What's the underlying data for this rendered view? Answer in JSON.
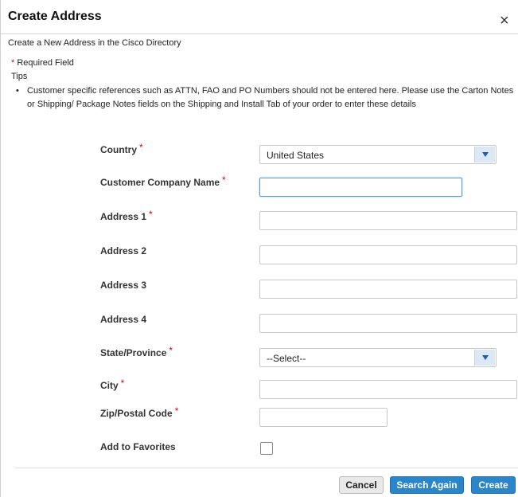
{
  "dialog": {
    "title": "Create Address",
    "close_glyph": "×",
    "subtitle": "Create a New Address in the Cisco Directory"
  },
  "notes": {
    "required_star": "*",
    "required_text": "Required Field",
    "tips_heading": "Tips",
    "tip_bullet": "•",
    "tip_text": "Customer specific references such as ATTN, FAO and PO Numbers should not be entered here. Please use the Carton Notes or Shipping/ Package Notes fields on the Shipping and Install Tab of your order to enter these details"
  },
  "form": {
    "required_star": "*",
    "country": {
      "label": "Country",
      "value": "United States"
    },
    "company": {
      "label": "Customer Company Name",
      "value": ""
    },
    "address1": {
      "label": "Address 1",
      "value": ""
    },
    "address2": {
      "label": "Address 2",
      "value": ""
    },
    "address3": {
      "label": "Address 3",
      "value": ""
    },
    "address4": {
      "label": "Address 4",
      "value": ""
    },
    "state": {
      "label": "State/Province",
      "value": "--Select--"
    },
    "city": {
      "label": "City",
      "value": ""
    },
    "zip": {
      "label": "Zip/Postal Code",
      "value": ""
    },
    "favorites": {
      "label": "Add to Favorites",
      "checked": false
    }
  },
  "buttons": {
    "cancel": "Cancel",
    "search_again": "Search Again",
    "create": "Create"
  },
  "colors": {
    "primary_button": "#2b86c9",
    "required_star": "#d0021b",
    "focus_border": "#5a9bd8"
  },
  "icons": {
    "close": "close-icon",
    "dropdown": "chevron-down-icon"
  }
}
